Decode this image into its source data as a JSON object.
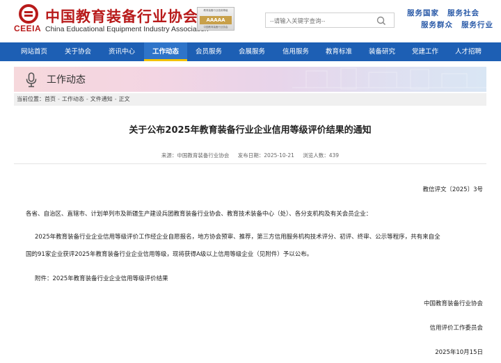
{
  "header": {
    "org_name_cn": "中国教育装备行业协会",
    "org_name_en": "China Educational Equipment Industry Association",
    "logo_text": "CEEIA",
    "badge": {
      "top_text": "教育装备行业信用等级",
      "rating": "AAAAA",
      "bottom_text": "中国教育装备行业协会"
    },
    "search_placeholder": "--请输入关键字查询--",
    "slogans": [
      "服务国家",
      "服务社会",
      "服务群众",
      "服务行业"
    ]
  },
  "nav": {
    "items": [
      "网站首页",
      "关于协会",
      "资讯中心",
      "工作动态",
      "会员服务",
      "会展服务",
      "信用服务",
      "教育标准",
      "装备研究",
      "党建工作",
      "人才招聘"
    ],
    "active_index": 3
  },
  "banner": {
    "title": "工作动态"
  },
  "breadcrumb": {
    "prefix": "当前位置：",
    "items": [
      "首页",
      "工作动态",
      "文件通知",
      "正文"
    ],
    "separator": "-"
  },
  "article": {
    "title": "关于公布2025年教育装备行业企业信用等级评价结果的通知",
    "meta": {
      "source": "来源：中国教育装备行业协会",
      "date": "发布日期：2025-10-21",
      "views": "浏览人数：439"
    },
    "doc_number": "教信评文〔2025〕3号",
    "salutation": "各省、自治区、直辖市、计划单列市及新疆生产建设兵团教育装备行业协会、教育技术装备中心（处）、各分支机构及有关会员企业：",
    "body_line1": "2025年教育装备行业企业信用等级评价工作经企业自愿报名，地方协会预审、推荐，第三方信用服务机构技术评分、初评、终审、公示等程序，共有来自全",
    "body_line2": "国的91家企业获评2025年教育装备行业企业信用等级，现将获得A级以上信用等级企业（见附件）予以公布。",
    "attachment": "附件：2025年教育装备行业企业信用等级评价结果",
    "signature_org": "中国教育装备行业协会",
    "signature_committee": "信用评价工作委员会",
    "signature_date": "2025年10月15日"
  },
  "colors": {
    "brand_red": "#b81b1b",
    "nav_blue": "#1d5fb4",
    "nav_active": "#2e74c9",
    "active_underline": "#f2c200"
  }
}
